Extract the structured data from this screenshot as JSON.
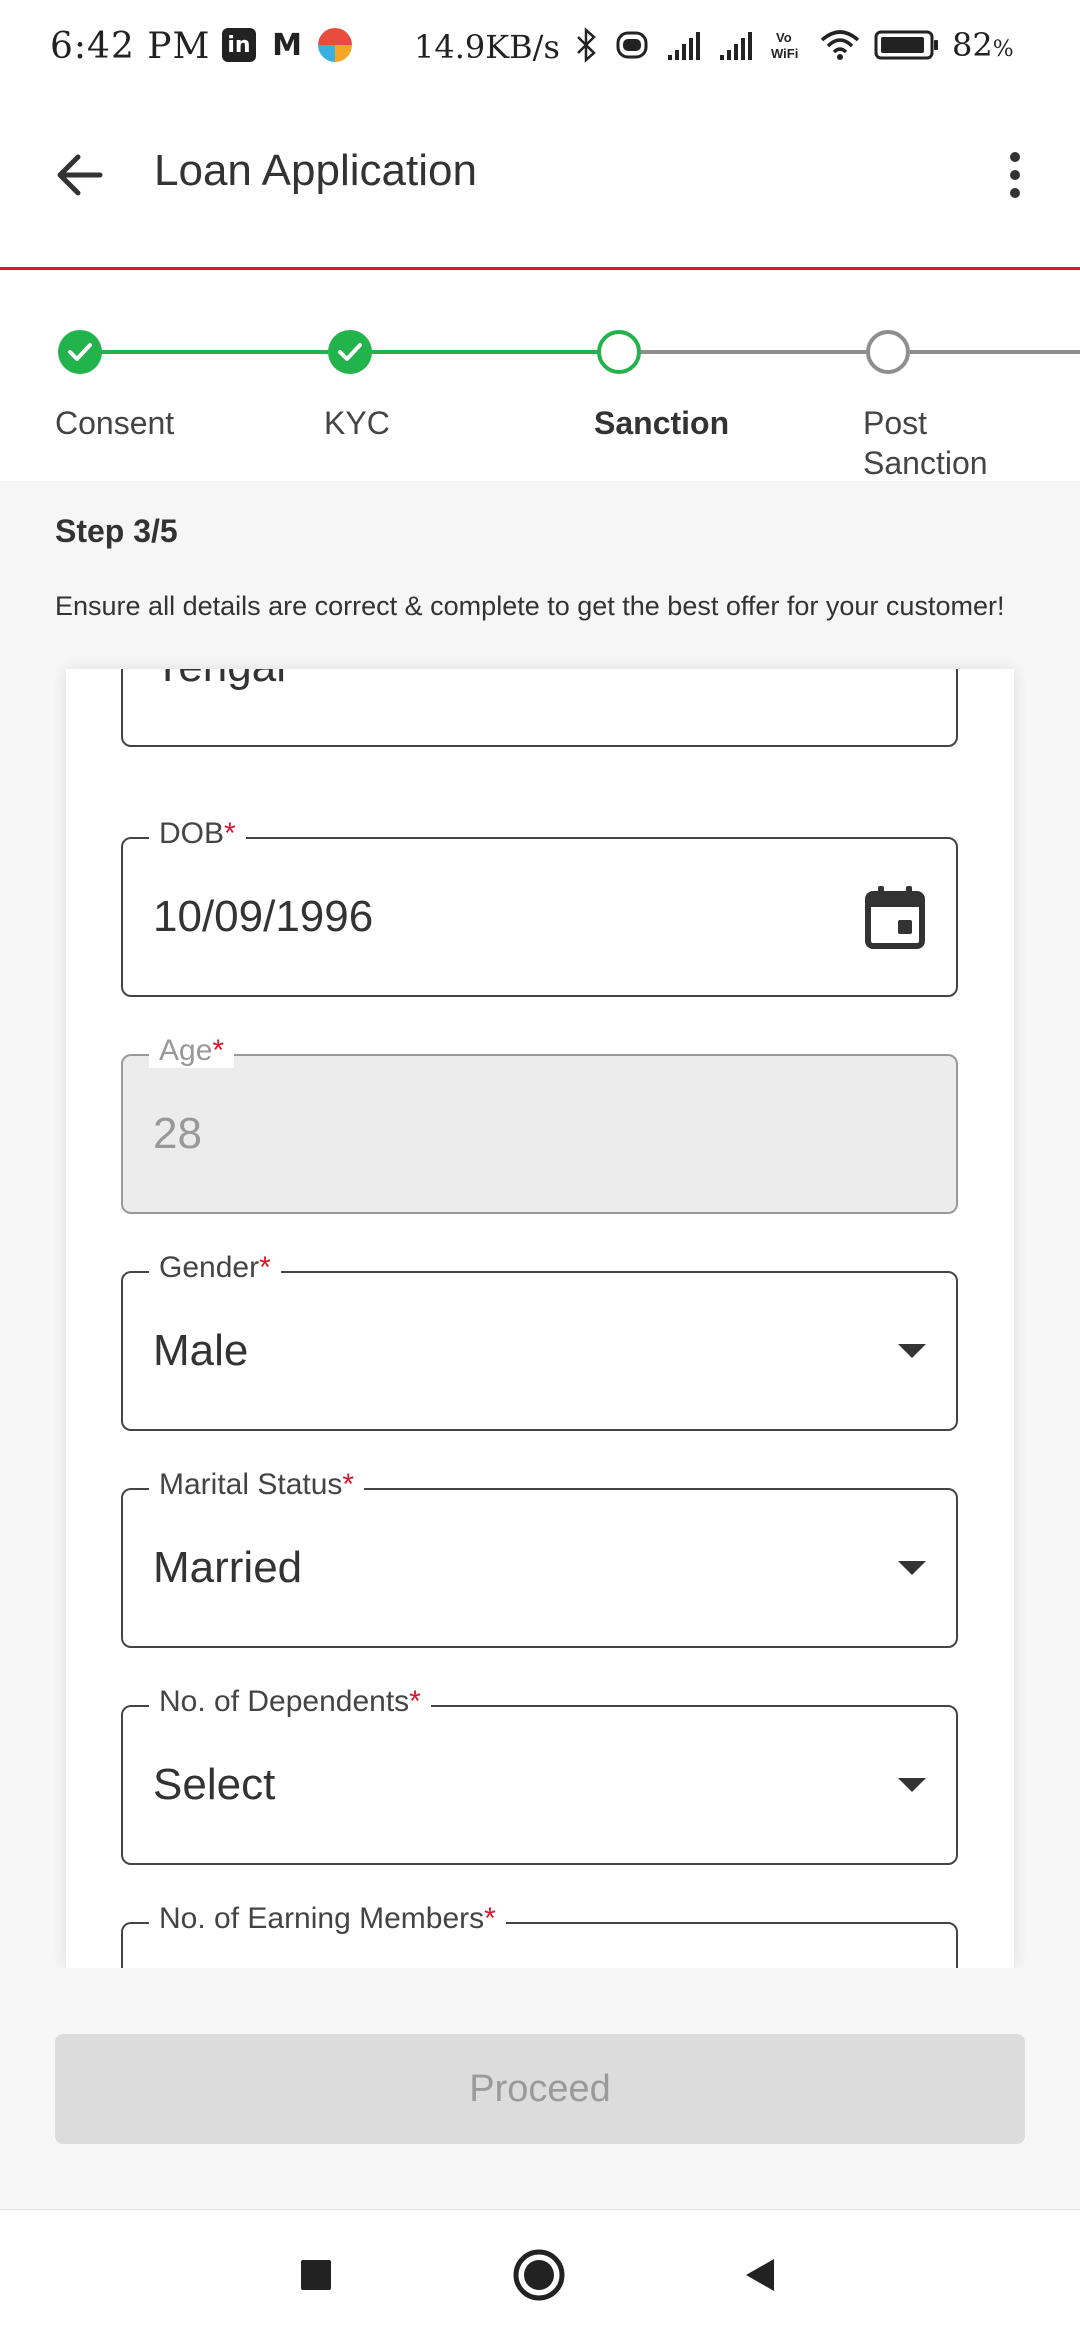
{
  "status_bar": {
    "time": "6:42 PM",
    "speed": "14.9KB/s",
    "battery": "82",
    "battery_unit": "%",
    "icons": [
      "linkedin-icon",
      "gmail-icon",
      "browser-icon",
      "bluetooth-icon",
      "vibrate-icon",
      "signal-icon",
      "signal-icon",
      "vowifi-icon",
      "wifi-icon",
      "battery-icon"
    ]
  },
  "header": {
    "title": "Loan Application"
  },
  "stepper": {
    "steps": [
      {
        "label": "Consent",
        "state": "done"
      },
      {
        "label": "KYC",
        "state": "done"
      },
      {
        "label": "Sanction",
        "state": "current"
      },
      {
        "label": "Post Sanction",
        "state": "todo"
      }
    ],
    "complete_color": "#22b34c",
    "incomplete_color": "#8e8e8e"
  },
  "info": {
    "step_count": "Step 3/5",
    "hint": "Ensure all details are correct & complete to get the best offer for your customer!"
  },
  "form": {
    "fields": [
      {
        "label": "",
        "value": "Yengal",
        "type": "text",
        "required": false
      },
      {
        "label": "DOB",
        "value": "10/09/1996",
        "type": "date",
        "required": true
      },
      {
        "label": "Age",
        "value": "28",
        "type": "text",
        "required": true,
        "disabled": true
      },
      {
        "label": "Gender",
        "value": "Male",
        "type": "select",
        "required": true
      },
      {
        "label": "Marital Status",
        "value": "Married",
        "type": "select",
        "required": true
      },
      {
        "label": "No. of Dependents",
        "value": "Select",
        "type": "select",
        "required": true
      },
      {
        "label": "No. of Earning Members",
        "value": "",
        "type": "select",
        "required": true
      }
    ],
    "required_marker": "*"
  },
  "footer": {
    "proceed_label": "Proceed"
  },
  "colors": {
    "brand_red": "#d7172f",
    "success_green": "#22b34c",
    "disabled_bg": "#dcdcdc"
  }
}
